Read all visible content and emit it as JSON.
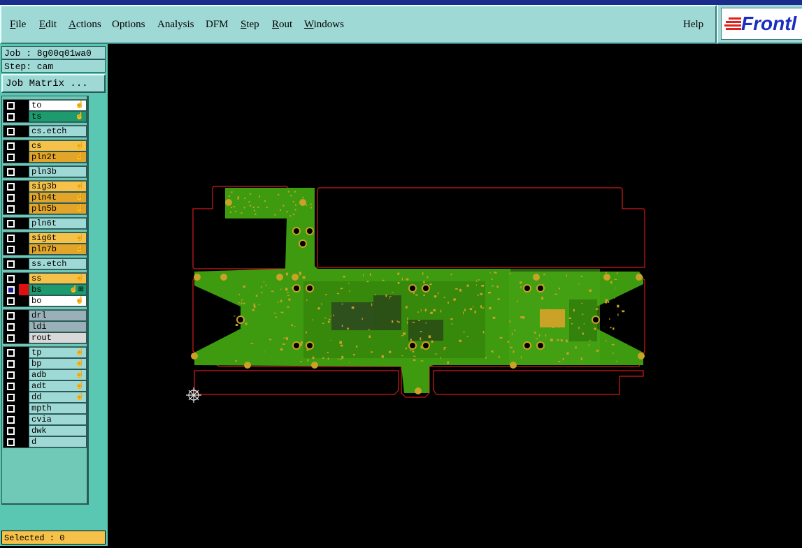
{
  "menu": {
    "items": [
      {
        "label": "File",
        "mn": "F",
        "rest": "ile"
      },
      {
        "label": "Edit",
        "mn": "E",
        "rest": "dit"
      },
      {
        "label": "Actions",
        "mn": "A",
        "rest": "ctions"
      },
      {
        "label": "Options",
        "mn": "",
        "rest": "Options"
      },
      {
        "label": "Analysis",
        "mn": "",
        "rest": "Analysis"
      },
      {
        "label": "DFM",
        "mn": "",
        "rest": "DFM"
      },
      {
        "label": "Step",
        "mn": "S",
        "rest": "tep"
      },
      {
        "label": "Rout",
        "mn": "R",
        "rest": "out"
      },
      {
        "label": "Windows",
        "mn": "W",
        "rest": "indows"
      }
    ],
    "help": "Help"
  },
  "logo": {
    "text": "Frontl",
    "colors": {
      "stripe": "#e0201a",
      "text": "#1a2fbf"
    }
  },
  "job": {
    "label": "Job : 8g00q01wa0",
    "step": "Step: cam",
    "matrix_button": "Job Matrix ..."
  },
  "layers": [
    [
      {
        "name": "to",
        "color": "#ffffff",
        "hand": "☝",
        "checked": false
      },
      {
        "name": "ts",
        "color": "#1d9a6e",
        "hand": "☝",
        "checked": false
      }
    ],
    [
      {
        "name": "cs.etch",
        "color": "#9fd9d6",
        "hand": "",
        "checked": false
      }
    ],
    [
      {
        "name": "cs",
        "color": "#f6c148",
        "hand": "☝",
        "checked": false
      },
      {
        "name": "pln2t",
        "color": "#e2a52a",
        "hand": "☝",
        "checked": false
      }
    ],
    [
      {
        "name": "pln3b",
        "color": "#9fd9d6",
        "hand": "",
        "checked": false
      }
    ],
    [
      {
        "name": "sig3b",
        "color": "#f6c148",
        "hand": "☝",
        "checked": false
      },
      {
        "name": "pln4t",
        "color": "#e2a52a",
        "hand": "☝",
        "checked": false
      },
      {
        "name": "pln5b",
        "color": "#e2a52a",
        "hand": "☝",
        "checked": false
      }
    ],
    [
      {
        "name": "pln6t",
        "color": "#9fd9d6",
        "hand": "",
        "checked": false
      }
    ],
    [
      {
        "name": "sig6t",
        "color": "#f6c148",
        "hand": "☝",
        "checked": false
      },
      {
        "name": "pln7b",
        "color": "#e2a52a",
        "hand": "☝",
        "checked": false
      }
    ],
    [
      {
        "name": "ss.etch",
        "color": "#9fd9d6",
        "hand": "",
        "checked": false
      }
    ],
    [
      {
        "name": "ss",
        "color": "#f6c148",
        "hand": "☝",
        "checked": false
      },
      {
        "name": "bs",
        "color": "#1d9a6e",
        "hand": "☝⊞",
        "checked": true,
        "swatch": "red"
      },
      {
        "name": "bo",
        "color": "#ffffff",
        "hand": "☝",
        "checked": false
      }
    ],
    [
      {
        "name": "drl",
        "color": "#9ab0b8",
        "hand": "",
        "checked": false
      },
      {
        "name": "ldi",
        "color": "#9ab0b8",
        "hand": "",
        "checked": false
      },
      {
        "name": "rout",
        "color": "#d8d8d8",
        "hand": "",
        "checked": false
      }
    ],
    [
      {
        "name": "tp",
        "color": "#9fd9d6",
        "hand": "☝",
        "checked": false
      },
      {
        "name": "bp",
        "color": "#9fd9d6",
        "hand": "☝",
        "checked": false
      },
      {
        "name": "adb",
        "color": "#9fd9d6",
        "hand": "☝",
        "checked": false
      },
      {
        "name": "adt",
        "color": "#9fd9d6",
        "hand": "☝",
        "checked": false
      },
      {
        "name": "dd",
        "color": "#9fd9d6",
        "hand": "☝",
        "checked": false
      },
      {
        "name": "mpth",
        "color": "#9fd9d6",
        "hand": "",
        "checked": false
      },
      {
        "name": "cvia",
        "color": "#9fd9d6",
        "hand": "",
        "checked": false
      },
      {
        "name": "dwk",
        "color": "#9fd9d6",
        "hand": "",
        "checked": false
      },
      {
        "name": "d",
        "color": "#9fd9d6",
        "hand": "",
        "checked": false
      }
    ]
  ],
  "status": {
    "selected": "Selected : 0"
  },
  "colors": {
    "board_fill": "#3e9b0f",
    "pad": "#c9a227",
    "profile": "#d01a1a",
    "background": "#000000"
  },
  "icons": {
    "origin": "crosshair-origin-icon"
  }
}
